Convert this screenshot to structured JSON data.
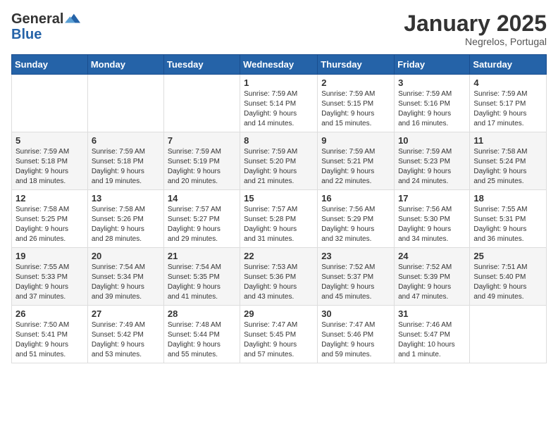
{
  "logo": {
    "general": "General",
    "blue": "Blue"
  },
  "header": {
    "month": "January 2025",
    "location": "Negrelos, Portugal"
  },
  "weekdays": [
    "Sunday",
    "Monday",
    "Tuesday",
    "Wednesday",
    "Thursday",
    "Friday",
    "Saturday"
  ],
  "weeks": [
    [
      {
        "day": "",
        "info": ""
      },
      {
        "day": "",
        "info": ""
      },
      {
        "day": "",
        "info": ""
      },
      {
        "day": "1",
        "info": "Sunrise: 7:59 AM\nSunset: 5:14 PM\nDaylight: 9 hours\nand 14 minutes."
      },
      {
        "day": "2",
        "info": "Sunrise: 7:59 AM\nSunset: 5:15 PM\nDaylight: 9 hours\nand 15 minutes."
      },
      {
        "day": "3",
        "info": "Sunrise: 7:59 AM\nSunset: 5:16 PM\nDaylight: 9 hours\nand 16 minutes."
      },
      {
        "day": "4",
        "info": "Sunrise: 7:59 AM\nSunset: 5:17 PM\nDaylight: 9 hours\nand 17 minutes."
      }
    ],
    [
      {
        "day": "5",
        "info": "Sunrise: 7:59 AM\nSunset: 5:18 PM\nDaylight: 9 hours\nand 18 minutes."
      },
      {
        "day": "6",
        "info": "Sunrise: 7:59 AM\nSunset: 5:18 PM\nDaylight: 9 hours\nand 19 minutes."
      },
      {
        "day": "7",
        "info": "Sunrise: 7:59 AM\nSunset: 5:19 PM\nDaylight: 9 hours\nand 20 minutes."
      },
      {
        "day": "8",
        "info": "Sunrise: 7:59 AM\nSunset: 5:20 PM\nDaylight: 9 hours\nand 21 minutes."
      },
      {
        "day": "9",
        "info": "Sunrise: 7:59 AM\nSunset: 5:21 PM\nDaylight: 9 hours\nand 22 minutes."
      },
      {
        "day": "10",
        "info": "Sunrise: 7:59 AM\nSunset: 5:23 PM\nDaylight: 9 hours\nand 24 minutes."
      },
      {
        "day": "11",
        "info": "Sunrise: 7:58 AM\nSunset: 5:24 PM\nDaylight: 9 hours\nand 25 minutes."
      }
    ],
    [
      {
        "day": "12",
        "info": "Sunrise: 7:58 AM\nSunset: 5:25 PM\nDaylight: 9 hours\nand 26 minutes."
      },
      {
        "day": "13",
        "info": "Sunrise: 7:58 AM\nSunset: 5:26 PM\nDaylight: 9 hours\nand 28 minutes."
      },
      {
        "day": "14",
        "info": "Sunrise: 7:57 AM\nSunset: 5:27 PM\nDaylight: 9 hours\nand 29 minutes."
      },
      {
        "day": "15",
        "info": "Sunrise: 7:57 AM\nSunset: 5:28 PM\nDaylight: 9 hours\nand 31 minutes."
      },
      {
        "day": "16",
        "info": "Sunrise: 7:56 AM\nSunset: 5:29 PM\nDaylight: 9 hours\nand 32 minutes."
      },
      {
        "day": "17",
        "info": "Sunrise: 7:56 AM\nSunset: 5:30 PM\nDaylight: 9 hours\nand 34 minutes."
      },
      {
        "day": "18",
        "info": "Sunrise: 7:55 AM\nSunset: 5:31 PM\nDaylight: 9 hours\nand 36 minutes."
      }
    ],
    [
      {
        "day": "19",
        "info": "Sunrise: 7:55 AM\nSunset: 5:33 PM\nDaylight: 9 hours\nand 37 minutes."
      },
      {
        "day": "20",
        "info": "Sunrise: 7:54 AM\nSunset: 5:34 PM\nDaylight: 9 hours\nand 39 minutes."
      },
      {
        "day": "21",
        "info": "Sunrise: 7:54 AM\nSunset: 5:35 PM\nDaylight: 9 hours\nand 41 minutes."
      },
      {
        "day": "22",
        "info": "Sunrise: 7:53 AM\nSunset: 5:36 PM\nDaylight: 9 hours\nand 43 minutes."
      },
      {
        "day": "23",
        "info": "Sunrise: 7:52 AM\nSunset: 5:37 PM\nDaylight: 9 hours\nand 45 minutes."
      },
      {
        "day": "24",
        "info": "Sunrise: 7:52 AM\nSunset: 5:39 PM\nDaylight: 9 hours\nand 47 minutes."
      },
      {
        "day": "25",
        "info": "Sunrise: 7:51 AM\nSunset: 5:40 PM\nDaylight: 9 hours\nand 49 minutes."
      }
    ],
    [
      {
        "day": "26",
        "info": "Sunrise: 7:50 AM\nSunset: 5:41 PM\nDaylight: 9 hours\nand 51 minutes."
      },
      {
        "day": "27",
        "info": "Sunrise: 7:49 AM\nSunset: 5:42 PM\nDaylight: 9 hours\nand 53 minutes."
      },
      {
        "day": "28",
        "info": "Sunrise: 7:48 AM\nSunset: 5:44 PM\nDaylight: 9 hours\nand 55 minutes."
      },
      {
        "day": "29",
        "info": "Sunrise: 7:47 AM\nSunset: 5:45 PM\nDaylight: 9 hours\nand 57 minutes."
      },
      {
        "day": "30",
        "info": "Sunrise: 7:47 AM\nSunset: 5:46 PM\nDaylight: 9 hours\nand 59 minutes."
      },
      {
        "day": "31",
        "info": "Sunrise: 7:46 AM\nSunset: 5:47 PM\nDaylight: 10 hours\nand 1 minute."
      },
      {
        "day": "",
        "info": ""
      }
    ]
  ]
}
